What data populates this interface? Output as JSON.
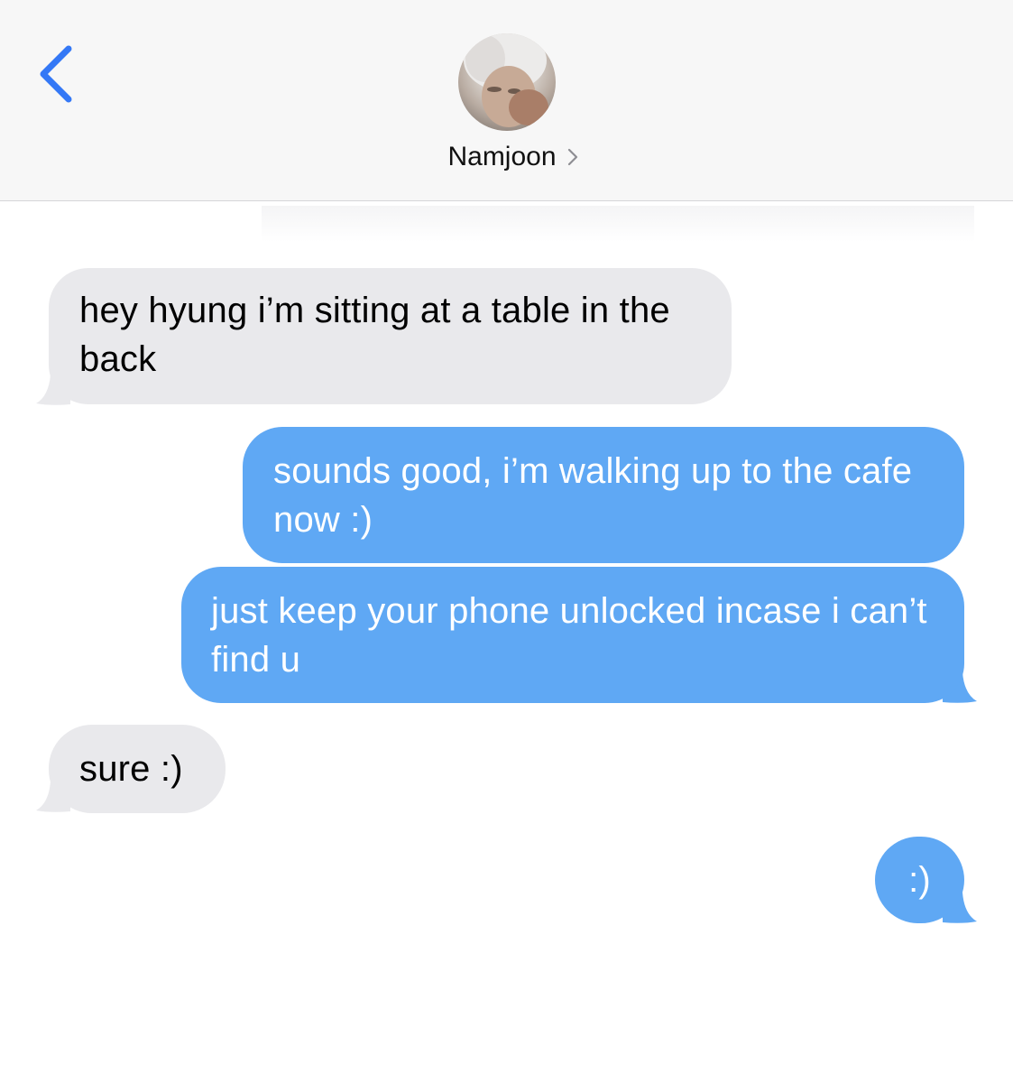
{
  "header": {
    "contact_name": "Namjoon",
    "back_icon": "chevron-left-icon",
    "name_chevron_icon": "chevron-right-icon",
    "avatar": "contact-avatar-photo"
  },
  "messages": [
    {
      "direction": "incoming",
      "text": "hey hyung i’m sitting at a table in the back"
    },
    {
      "direction": "outgoing",
      "text": "sounds good, i’m walking up to the cafe now :)"
    },
    {
      "direction": "outgoing",
      "text": "just keep your phone unlocked incase i can’t find u"
    },
    {
      "direction": "incoming",
      "text": "sure :)"
    },
    {
      "direction": "outgoing",
      "text": ":)"
    }
  ],
  "colors": {
    "accent_blue": "#3478f6",
    "outgoing_bubble": "#5fa8f4",
    "incoming_bubble": "#e9e9ec",
    "header_bg": "#f7f7f7"
  }
}
